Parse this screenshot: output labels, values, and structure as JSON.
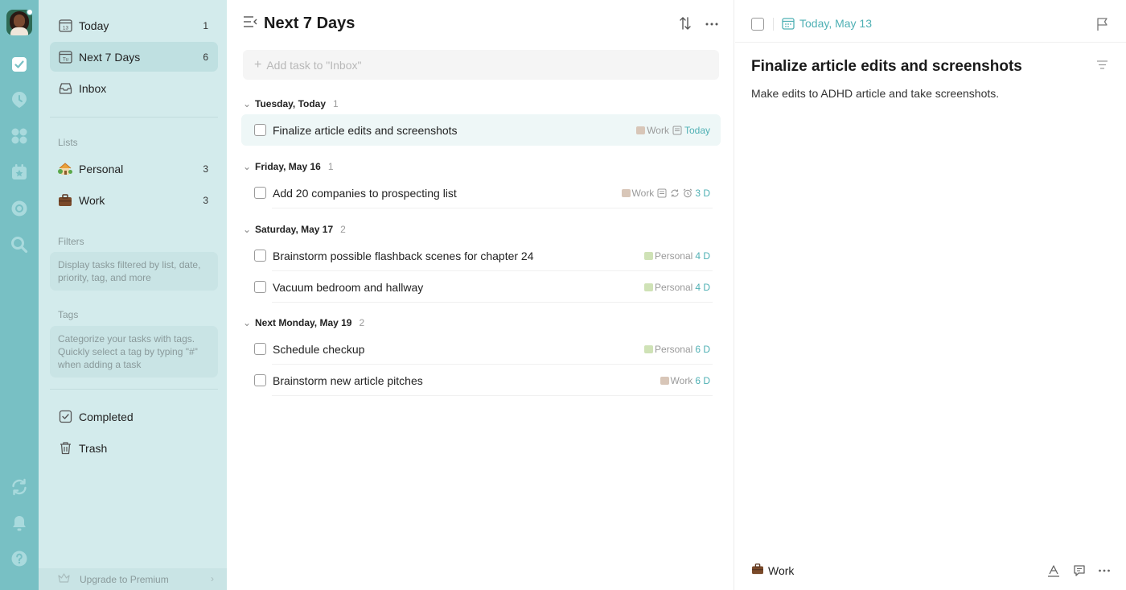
{
  "sidebar": {
    "smart_lists": [
      {
        "label": "Today",
        "count": "1",
        "icon": "calendar-13-icon",
        "icon_text": "13"
      },
      {
        "label": "Next 7 Days",
        "count": "6",
        "icon": "calendar-tu-icon",
        "icon_text": "Tu"
      },
      {
        "label": "Inbox",
        "count": "",
        "icon": "inbox-icon"
      }
    ],
    "lists_title": "Lists",
    "lists": [
      {
        "label": "Personal",
        "count": "3",
        "icon": "house-icon"
      },
      {
        "label": "Work",
        "count": "3",
        "icon": "briefcase-icon"
      }
    ],
    "filters_title": "Filters",
    "filters_hint": "Display tasks filtered by list, date, priority, tag, and more",
    "tags_title": "Tags",
    "tags_hint": "Categorize your tasks with tags. Quickly select a tag by typing \"#\" when adding a task",
    "bottom": [
      {
        "label": "Completed",
        "icon": "checkbox-icon"
      },
      {
        "label": "Trash",
        "icon": "trash-icon"
      }
    ],
    "upgrade": "Upgrade to Premium"
  },
  "main": {
    "title": "Next 7 Days",
    "add_task_placeholder": "Add task to \"Inbox\"",
    "groups": [
      {
        "label": "Tuesday, Today",
        "count": "1",
        "tasks": [
          {
            "title": "Finalize article edits and screenshots",
            "list": "Work",
            "due": "Today"
          }
        ]
      },
      {
        "label": "Friday, May 16",
        "count": "1",
        "tasks": [
          {
            "title": "Add 20 companies to prospecting list",
            "list": "Work",
            "due": "3 D"
          }
        ]
      },
      {
        "label": "Saturday, May 17",
        "count": "2",
        "tasks": [
          {
            "title": "Brainstorm possible flashback scenes for chapter 24",
            "list": "Personal",
            "due": "4 D"
          },
          {
            "title": "Vacuum bedroom and hallway",
            "list": "Personal",
            "due": "4 D"
          }
        ]
      },
      {
        "label": "Next Monday, May 19",
        "count": "2",
        "tasks": [
          {
            "title": "Schedule checkup",
            "list": "Personal",
            "due": "6 D"
          },
          {
            "title": "Brainstorm new article pitches",
            "list": "Work",
            "due": "6 D"
          }
        ]
      }
    ]
  },
  "detail": {
    "date": "Today, May 13",
    "title": "Finalize article edits and screenshots",
    "description": "Make edits to ADHD article and take screenshots.",
    "list": "Work"
  },
  "colors": {
    "rail": "#78c0c4",
    "sidebar": "#d3ebec",
    "accent": "#4fb0b4"
  }
}
